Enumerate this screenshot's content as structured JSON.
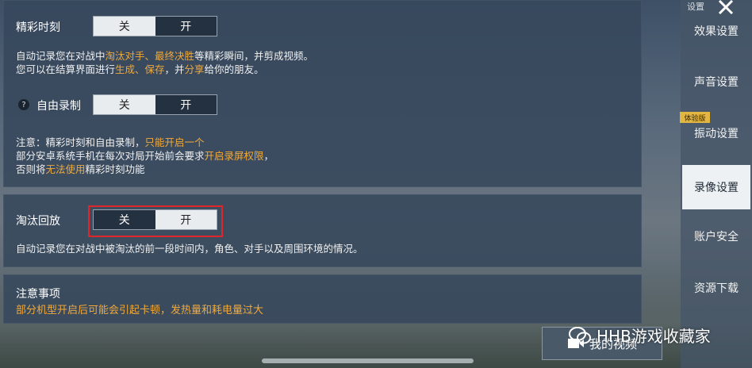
{
  "highlight_section": {
    "label": "精彩时刻",
    "toggle_off": "关",
    "toggle_on": "开",
    "desc_line1": [
      "自动记录您在对战中",
      "淘汰对手、最终决胜",
      "等精彩瞬间，并剪成视频。"
    ],
    "desc_line2": [
      "您可以在结算界面进行",
      "生成、保存",
      "，并",
      "分享",
      "给你的朋友。"
    ]
  },
  "free_record": {
    "help_icon": "question-icon",
    "help_glyph": "?",
    "label": "自由录制",
    "toggle_off": "关",
    "toggle_on": "开"
  },
  "notice": {
    "line1": [
      "注意：精彩时刻和自由录制，",
      "只能开启一个"
    ],
    "line2": [
      "部分安卓系统手机在每次对局开始前会要求",
      "开启录屏权限",
      "，"
    ],
    "line3": [
      "否则将",
      "无法使用",
      "精彩时刻功能"
    ]
  },
  "elimination_replay": {
    "label": "淘汰回放",
    "toggle_off": "关",
    "toggle_on": "开",
    "desc": "自动记录您在对战中被淘汰的前一段时间内，角色、对手以及周围环境的情况。"
  },
  "precautions": {
    "title": "注意事项",
    "warning": "部分机型开启后可能会引起卡顿，发热量和耗电量过大"
  },
  "sidebar": {
    "title": "设置",
    "close_icon": "close-icon",
    "trial_badge": "体验版",
    "items": [
      "效果设置",
      "声音设置",
      "振动设置",
      "录像设置",
      "账户安全",
      "资源下载"
    ],
    "active": "录像设置"
  },
  "my_video_button": {
    "icon": "video-icon",
    "label": "我的视频"
  },
  "watermark": {
    "icon": "wechat-icon",
    "text": "HHB游戏收藏家"
  },
  "colors": {
    "accent": "#f0a93a",
    "highlight_box": "#e0262a",
    "active_tab": "#eef1f4"
  }
}
